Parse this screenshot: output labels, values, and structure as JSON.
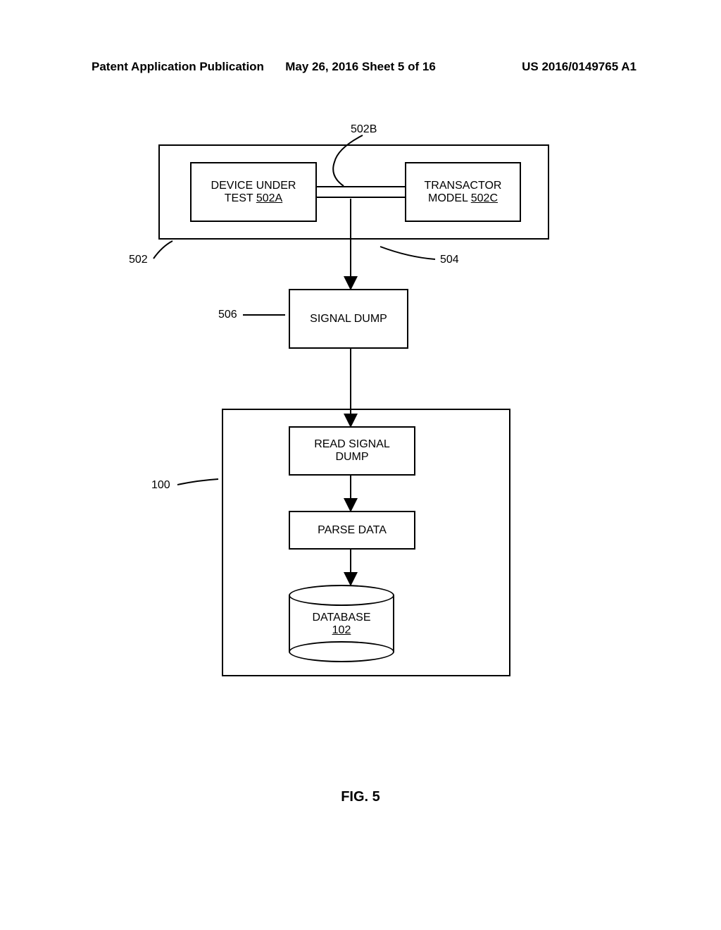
{
  "header": {
    "left": "Patent Application Publication",
    "center": "May 26, 2016  Sheet 5 of 16",
    "right": "US 2016/0149765 A1"
  },
  "boxes": {
    "dut_line1": "DEVICE UNDER",
    "dut_line2": "TEST ",
    "dut_ref": "502A",
    "transactor_line1": "TRANSACTOR",
    "transactor_line2": "MODEL ",
    "transactor_ref": "502C",
    "signal_dump": "SIGNAL DUMP",
    "read_signal_line1": "READ SIGNAL",
    "read_signal_line2": "DUMP",
    "parse_data": "PARSE DATA",
    "database": "DATABASE",
    "database_ref": "102"
  },
  "refs": {
    "r502b": "502B",
    "r502": "502",
    "r504": "504",
    "r506": "506",
    "r100": "100"
  },
  "figure": "FIG. 5"
}
